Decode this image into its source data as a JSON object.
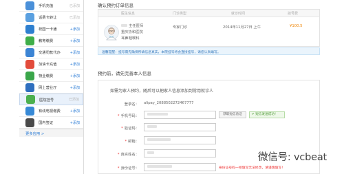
{
  "sidebar": {
    "items": [
      {
        "label": "手机充值",
        "action": "已添加",
        "added": true,
        "color": "#4a90d9"
      },
      {
        "label": "话费卡转让",
        "action": "已添加",
        "added": true,
        "color": "#5aa0e0"
      },
      {
        "label": "校园一卡通",
        "action": "+添加",
        "added": false,
        "color": "#2e7fcf"
      },
      {
        "label": "教育缴费",
        "action": "+添加",
        "added": false,
        "color": "#3fae49"
      },
      {
        "label": "交通罚款代办",
        "action": "+添加",
        "added": false,
        "color": "#3b84d4"
      },
      {
        "label": "加油卡充值",
        "action": "+添加",
        "added": false,
        "color": "#e24b3b"
      },
      {
        "label": "物业缴费",
        "action": "+添加",
        "added": false,
        "color": "#3aa64a"
      },
      {
        "label": "网上营业厅",
        "action": "+添加",
        "added": false,
        "color": "#2f6fbf"
      },
      {
        "label": "医院挂号",
        "action": "已添加",
        "added": true,
        "color": "#4cb04f",
        "active": true
      },
      {
        "label": "有线电视缴费",
        "action": "+添加",
        "added": false,
        "color": "#3789d6"
      },
      {
        "label": "国内签证",
        "action": "+添加",
        "added": false,
        "color": "#4a4a4a"
      }
    ],
    "more": "更多应用 >"
  },
  "confirm": {
    "title": "确认预约订单信息",
    "headers": [
      "医生信息",
      "门诊类型",
      "就诊时间",
      "挂号费"
    ],
    "doctor_title": "主任医师",
    "doctor_hospital": "重庆协和医院",
    "doctor_dept": "耳鼻咽喉科",
    "clinic_type": "专家门诊",
    "visit_time": "2014年11月27日 上午",
    "fee": "¥100.5"
  },
  "notice": "温馨提醒：挂号需先确保所填信息真实，本院挂号将会直接挂号，请您认真填写。",
  "fill": {
    "title": "预约前，请先完善本人信息",
    "hint": "如需为家人预约，随后可以把家人信息添加到常用就诊人",
    "login_label": "登录名：",
    "login_value": "alipay_2088502272467777",
    "phone_label": "手机号码：",
    "sms_button": "获取短信验证",
    "ok_tip": "✔ 短信发送成功！",
    "code_label": "验证码：",
    "email_label": "邮箱：",
    "name_label": "真实姓名：",
    "id_label": "身份证号：",
    "id_error": "身份证号码一经填写无法修改，请谨慎填写！"
  },
  "watermark": "微信号: vcbeat"
}
